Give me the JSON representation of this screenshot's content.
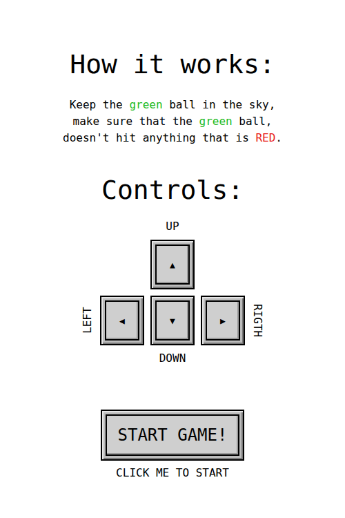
{
  "instructions": {
    "title": "How it works:",
    "lines": [
      [
        {
          "text": "Keep the ",
          "color": "#000000"
        },
        {
          "text": "green",
          "color": "#22bb22"
        },
        {
          "text": " ball in the sky,",
          "color": "#000000"
        }
      ],
      [
        {
          "text": "make sure that the ",
          "color": "#000000"
        },
        {
          "text": "green",
          "color": "#22bb22"
        },
        {
          "text": " ball,",
          "color": "#000000"
        }
      ],
      [
        {
          "text": "doesn't hit anything that is ",
          "color": "#000000"
        },
        {
          "text": "RED",
          "color": "#e81c1c"
        },
        {
          "text": ".",
          "color": "#000000"
        }
      ]
    ]
  },
  "controls": {
    "title": "Controls:",
    "keys": [
      {
        "kind": "up",
        "label": "UP",
        "icon": "▲"
      },
      {
        "kind": "left",
        "label": "LEFT",
        "icon": "◀"
      },
      {
        "kind": "down",
        "label": "DOWN",
        "icon": "▼"
      },
      {
        "kind": "right",
        "label": "RIGTH",
        "icon": "▶"
      }
    ]
  },
  "start": {
    "button": "START GAME!",
    "caption": "CLICK ME TO START"
  }
}
